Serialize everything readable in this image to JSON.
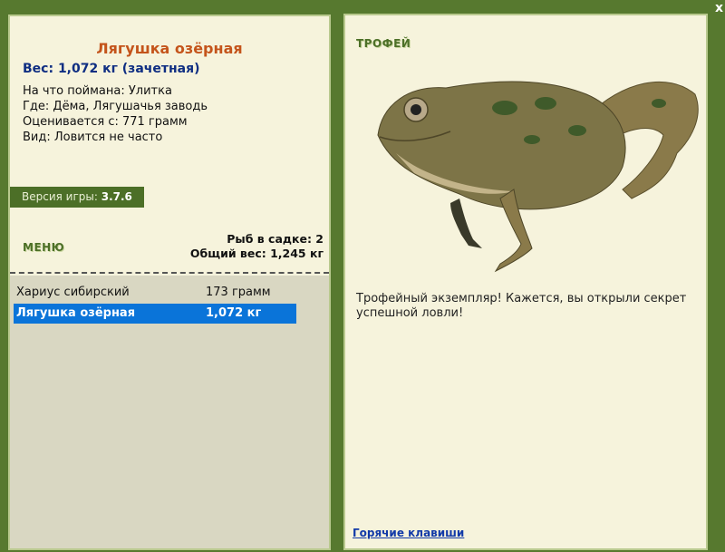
{
  "catch_card": {
    "fish_name": "Лягушка озёрная",
    "weight_line": "Вес: 1,072 кг (зачетная)",
    "details": [
      "На что поймана: Улитка",
      "Где: Дёма, Лягушачья заводь",
      "Оценивается с: 771 грамм",
      "Вид: Ловится не часто"
    ]
  },
  "version": {
    "label": "Версия игры:",
    "value": "3.7.6"
  },
  "menu": {
    "label": "МЕНЮ"
  },
  "keep_net": {
    "count_line": "Рыб в садке: 2",
    "total_line": "Общий вес: 1,245 кг"
  },
  "fish_list": [
    {
      "name": "Хариус сибирский",
      "weight": "173 грамм",
      "selected": false
    },
    {
      "name": "Лягушка озёрная",
      "weight": "1,072 кг",
      "selected": true
    }
  ],
  "trophy": {
    "label": "ТРОФЕЙ",
    "text": "Трофейный экземпляр! Кажется, вы открыли секрет успешной ловли!"
  },
  "hotkeys": {
    "label": "Горячие клавиши"
  },
  "window": {
    "close_glyph": "x"
  },
  "colors": {
    "background": "#57792f",
    "panel": "#f6f3dc",
    "title": "#c4541b",
    "weight": "#0f2e82",
    "selection": "#0a74d9"
  }
}
